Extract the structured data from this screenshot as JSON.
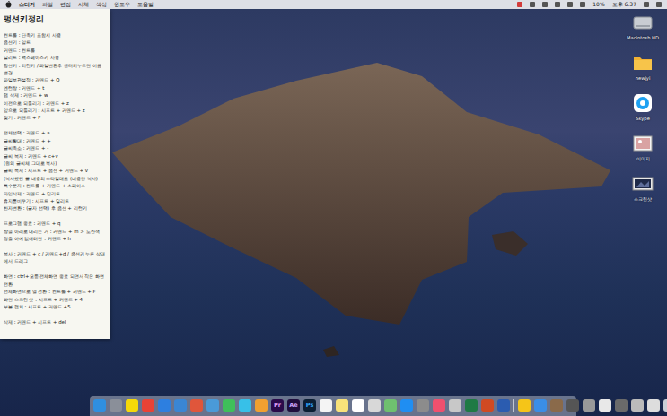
{
  "menu_bar": {
    "app_name": "스티커",
    "menus": [
      "파일",
      "편집",
      "서체",
      "색상",
      "윈도우",
      "도움말"
    ],
    "status": [
      "10%",
      "오후 6:37"
    ]
  },
  "sticky": {
    "title": "펑션키정리",
    "sections": [
      {
        "lines": [
          "컨트롤 : 단축키 조합시 사용",
          "옵션키 : 알트",
          "커맨드 : 컨트롤",
          "딜리트 : 백스페이스키 사용",
          "펑션키 : 리턴키 / 파일변환후 엔터키누르면 이름 변경",
          "파일보관설정 : 커맨드 + Q",
          "엔턴창 : 커맨드 + t",
          "탭 삭제 : 커맨드 + w",
          "이전으로 되돌리기 : 커맨드 + z",
          "앞으로 되돌리기 : 시프트 + 커맨드 + z",
          "찾기 : 커맨드 + F"
        ]
      },
      {
        "lines": [
          "전체선택 : 커맨드 + a",
          "글씨확대 : 커맨드 + +",
          "글씨축소 : 커맨드 + -",
          "글씨 복제 : 커맨드 + c+v",
          "(원의 글씨체 그대로 복사)",
          "글씨 복제 : 시프트 + 옵션 + 커맨드 + v",
          "(복사했던 글 내용의 스타일대로 (내용만 복사)",
          "특수문자 : 컨트롤 + 커맨드 + 스페이스",
          "파일삭제 : 커맨드 + 딜리트",
          "휴지통비우기 : 시프트 + 딜리트",
          "한자변환 : (글자 선택) 후 옵션 + 리턴키"
        ]
      },
      {
        "lines": [
          "프로그램 종료 : 커맨드 + q",
          "창을 아래로 내리는 거 : 커맨드 + m > 노란색",
          "창을 아예 없애려면 : 커맨드 + h"
        ]
      },
      {
        "lines": [
          "복사 : 커맨드 + c / 커맨드+d / 옵션키 누른 상태에서 드래그"
        ]
      },
      {
        "lines": [
          "화면 : ctrl+모퉁 전체화면 종료 되면서 작은 화면 전환",
          "전체화면으로 열 전환 : 컨트롤 + 커맨드 + F",
          "화면 스크린 샷 : 시프트 + 커맨드 + 4",
          "부분 캡쳐 : 시프트 + 커맨드 +5"
        ]
      },
      {
        "lines": [
          "삭제 : 커맨드 + 시프트 + del"
        ]
      }
    ]
  },
  "desktop_icons": [
    {
      "label": "Macintosh HD",
      "kind": "drive"
    },
    {
      "label": "newjyi",
      "kind": "folder"
    },
    {
      "label": "Skype",
      "kind": "app"
    },
    {
      "label": "이미지",
      "kind": "image"
    },
    {
      "label": "스크린샷",
      "kind": "screen"
    }
  ],
  "dock": {
    "items": [
      {
        "color": "#2f8fe0"
      },
      {
        "color": "#8a8f99"
      },
      {
        "color": "#f5d90a"
      },
      {
        "color": "#e94235"
      },
      {
        "color": "#2d7fe0"
      },
      {
        "color": "#3a86d4"
      },
      {
        "color": "#e0563b"
      },
      {
        "color": "#4a9ad8"
      },
      {
        "color": "#3fbf5a"
      },
      {
        "color": "#37c0e8"
      },
      {
        "color": "#f0a030"
      },
      {
        "color": "#2a0a4a",
        "label": "Pr",
        "text_color": "#e4a0ff"
      },
      {
        "color": "#1f0e3d",
        "label": "Ae",
        "text_color": "#c7a0ff"
      },
      {
        "color": "#0b1e33",
        "label": "Ps",
        "text_color": "#31a8ff"
      },
      {
        "color": "#f4f4f4"
      },
      {
        "color": "#f8e27a"
      },
      {
        "color": "#ffffff"
      },
      {
        "color": "#d8d8d8"
      },
      {
        "color": "#6fc06f"
      },
      {
        "color": "#1f8ef2"
      },
      {
        "color": "#8c8c8c"
      },
      {
        "color": "#f0506e"
      },
      {
        "color": "#c8c8c8"
      },
      {
        "color": "#1f7a44"
      },
      {
        "color": "#d04a22"
      },
      {
        "color": "#2b5cb0"
      },
      {
        "color": "#f5c518"
      },
      {
        "color": "#3a8ee6"
      },
      {
        "color": "#8a6a4a"
      },
      {
        "color": "#555555"
      },
      {
        "color": "#999999"
      },
      {
        "color": "#e8e8e8"
      },
      {
        "color": "#6a6a6a"
      },
      {
        "color": "#bbbbbb"
      },
      {
        "color": "#dddddd"
      },
      {
        "color": "#c9ced6"
      }
    ]
  }
}
